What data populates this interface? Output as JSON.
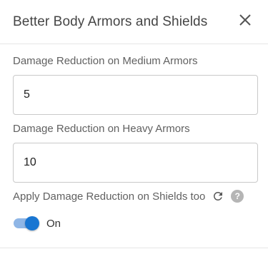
{
  "dialog": {
    "title": "Better Body Armors and Shields",
    "close_icon": "close-icon"
  },
  "fields": [
    {
      "label": "Damage Reduction on Medium Armors",
      "value": "5"
    },
    {
      "label": "Damage Reduction on Heavy Armors",
      "value": "10"
    }
  ],
  "shields": {
    "label": "Apply Damage Reduction on Shields too",
    "reset_icon": "reset-icon",
    "help_icon": "help-icon",
    "help_glyph": "?",
    "toggle_state": "On",
    "toggle_on": true
  },
  "colors": {
    "accent": "#1976d2",
    "toggle_track": "#8fb6e6",
    "help_icon_bg": "#b5b5b5"
  }
}
